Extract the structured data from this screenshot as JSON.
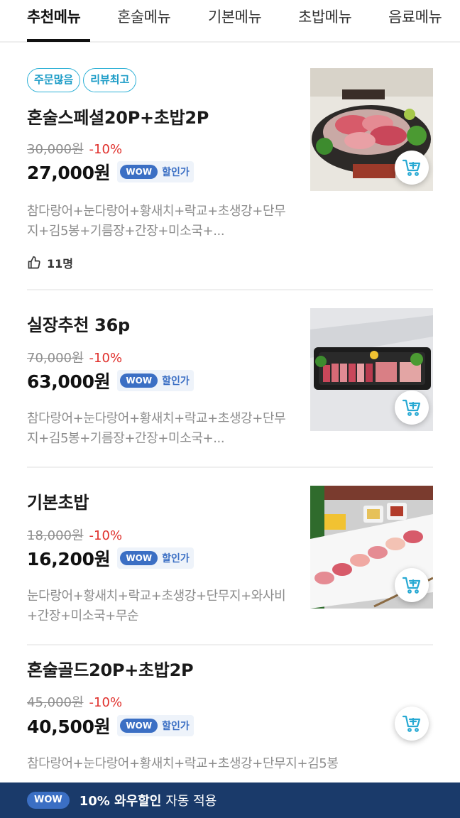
{
  "tabs": [
    {
      "label": "추천메뉴",
      "active": true
    },
    {
      "label": "혼술메뉴",
      "active": false
    },
    {
      "label": "기본메뉴",
      "active": false
    },
    {
      "label": "초밥메뉴",
      "active": false
    },
    {
      "label": "음료메뉴",
      "active": false
    }
  ],
  "items": [
    {
      "badges": [
        "주문많음",
        "리뷰최고"
      ],
      "name": " 혼술스페셜20P+초밥2P",
      "original_price": "30,000원",
      "discount": "-10%",
      "price": "27,000원",
      "wow_pill": "WOW",
      "wow_label": "할인가",
      "description": "참다랑어+눈다랑어+황새치+락교+초생강+단무지+김5봉+기름장+간장+미소국+...",
      "likes": "11명"
    },
    {
      "name": "실장추천 36p",
      "original_price": "70,000원",
      "discount": "-10%",
      "price": "63,000원",
      "wow_pill": "WOW",
      "wow_label": "할인가",
      "description": "참다랑어+눈다랑어+황새치+락교+초생강+단무지+김5봉+기름장+간장+미소국+..."
    },
    {
      "name": "기본초밥",
      "original_price": "18,000원",
      "discount": "-10%",
      "price": "16,200원",
      "wow_pill": "WOW",
      "wow_label": "할인가",
      "description": " 눈다랑어+황새치+락교+초생강+단무지+와사비+간장+미소국+무순"
    },
    {
      "name": "혼술골드20P+초밥2P",
      "original_price": "45,000원",
      "discount": "-10%",
      "price": "40,500원",
      "wow_pill": "WOW",
      "wow_label": "할인가",
      "description": "참다랑어+눈다랑어+황새치+락교+초생강+단무지+김5봉"
    }
  ],
  "banner": {
    "pill": "WOW",
    "bold_text": "10% 와우할인",
    "normal_text": "자동 적용"
  },
  "colors": {
    "accent_blue": "#3b6fc4",
    "badge_cyan": "#2fb1d6",
    "discount_red": "#e0312d",
    "banner_navy": "#1a3a6a"
  },
  "icons": [
    "thumbs-up-icon",
    "add-to-cart-icon"
  ]
}
